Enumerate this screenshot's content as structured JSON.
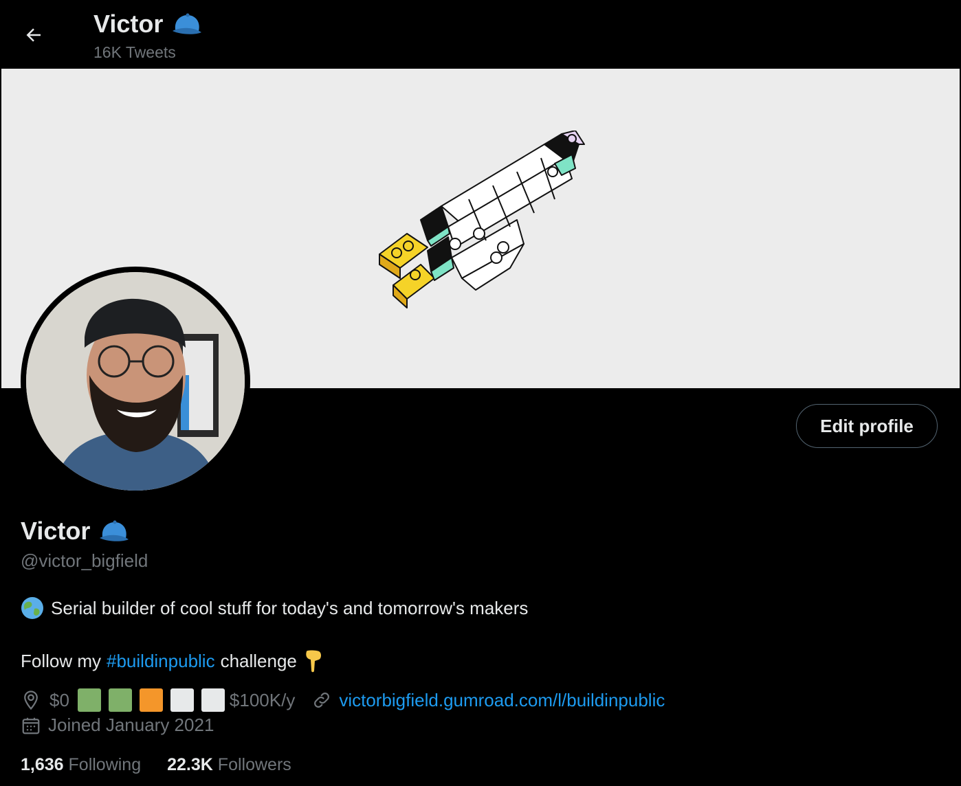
{
  "header": {
    "title": "Victor",
    "tweets_count": "16K Tweets"
  },
  "profile": {
    "name": "Victor",
    "handle": "@victor_bigfield",
    "edit_label": "Edit profile",
    "bio_line1": "Serial builder of cool stuff for today's and tomorrow's makers",
    "bio_line2_prefix": "Follow my",
    "bio_hashtag": "#buildinpublic",
    "bio_line2_suffix": "challenge",
    "location_start": "$0",
    "location_end": "$100K/y",
    "progress_squares": [
      "#7fb069",
      "#7fb069",
      "#f4962a",
      "#e7e9ea",
      "#e7e9ea"
    ],
    "progress_filled_fraction": 0.6,
    "website": "victorbigfield.gumroad.com/l/buildinpublic",
    "joined": "Joined January 2021"
  },
  "stats": {
    "following_count": "1,636",
    "following_label": "Following",
    "followers_count": "22.3K",
    "followers_label": "Followers"
  },
  "colors": {
    "accent": "#1d9bf0",
    "secondary_text": "#71767b",
    "banner_bg": "#ececec"
  },
  "icons": [
    "back-arrow-icon",
    "cap-emoji-icon",
    "globe-emoji-icon",
    "pointing-down-emoji-icon",
    "location-pin-icon",
    "link-icon",
    "calendar-icon"
  ]
}
